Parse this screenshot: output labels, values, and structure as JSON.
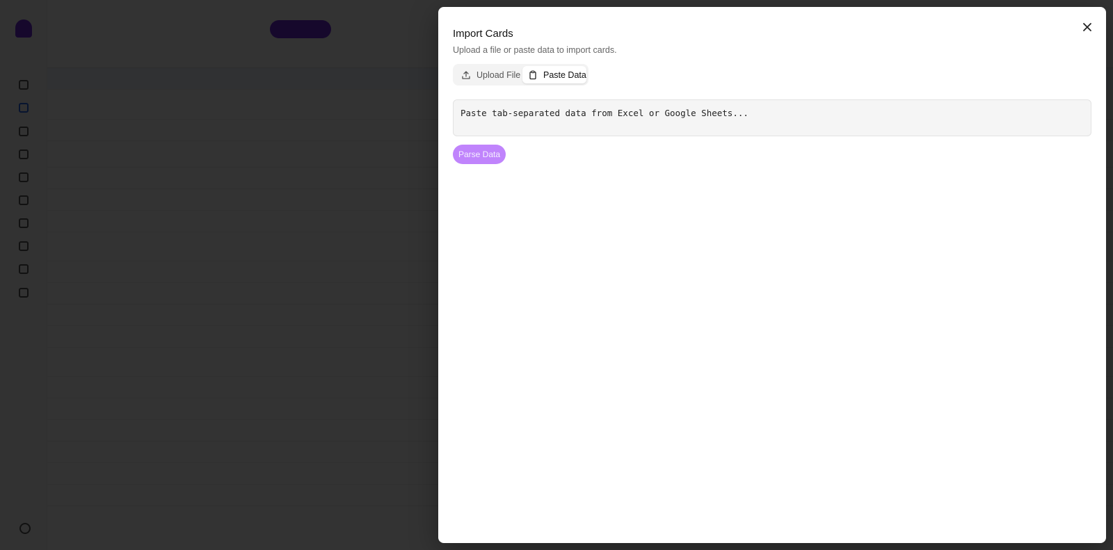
{
  "modal": {
    "title": "Import Cards",
    "description": "Upload a file or paste data to import cards.",
    "close_icon": "x-icon",
    "tabs": [
      {
        "label": "Upload File",
        "icon": "upload-icon",
        "active": false
      },
      {
        "label": "Paste Data",
        "icon": "clipboard-icon",
        "active": true
      }
    ],
    "paste_placeholder": "Paste tab-separated data from Excel or Google Sheets...",
    "parse_button_label": "Parse Data"
  },
  "colors": {
    "accent": "#6d28d9",
    "parse_button": "#c084fc",
    "overlay": "rgba(0,0,0,0.80)"
  }
}
